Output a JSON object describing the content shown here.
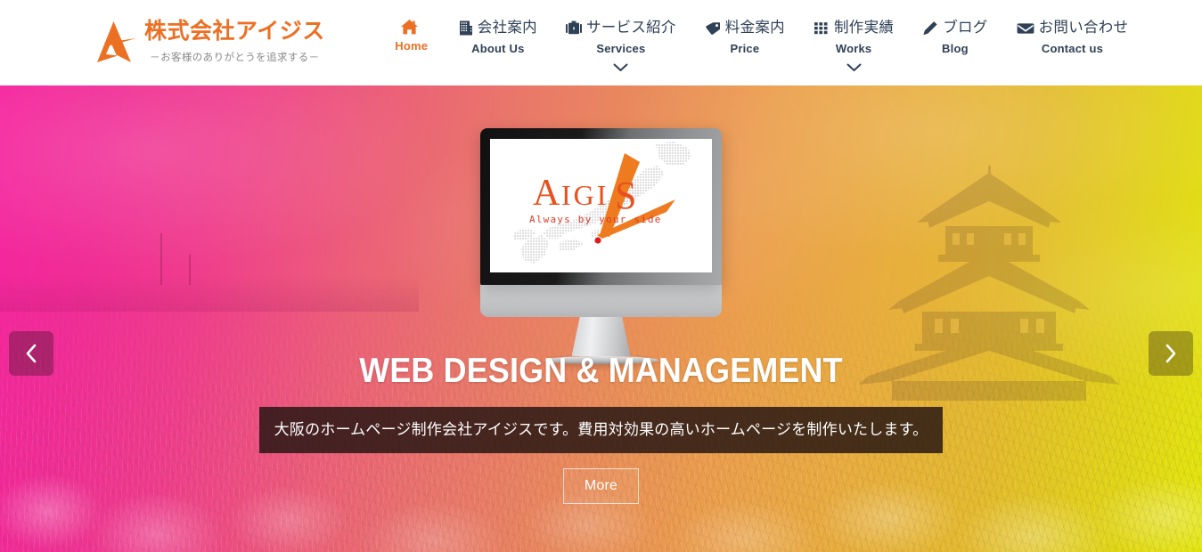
{
  "header": {
    "brand": {
      "logo_icon": "aigis-a-mark-icon",
      "name": "株式会社アイジス",
      "tagline": "－お客様のありがとうを追求する－",
      "accent_color": "#ec7024"
    },
    "nav": {
      "inactive_color": "#2f4156",
      "active_color": "#ec7024",
      "items": [
        {
          "id": "home",
          "icon": "home-icon",
          "ja": "",
          "en": "Home",
          "active": true,
          "has_dropdown": false
        },
        {
          "id": "about",
          "icon": "building-icon",
          "ja": "会社案内",
          "en": "About Us",
          "active": false,
          "has_dropdown": false
        },
        {
          "id": "services",
          "icon": "briefcase-icon",
          "ja": "サービス紹介",
          "en": "Services",
          "active": false,
          "has_dropdown": true
        },
        {
          "id": "price",
          "icon": "tag-icon",
          "ja": "料金案内",
          "en": "Price",
          "active": false,
          "has_dropdown": false
        },
        {
          "id": "works",
          "icon": "grid-icon",
          "ja": "制作実績",
          "en": "Works",
          "active": false,
          "has_dropdown": true
        },
        {
          "id": "blog",
          "icon": "pencil-icon",
          "ja": "ブログ",
          "en": "Blog",
          "active": false,
          "has_dropdown": false
        },
        {
          "id": "contact",
          "icon": "envelope-icon",
          "ja": "お問い合わせ",
          "en": "Contact us",
          "active": false,
          "has_dropdown": false
        }
      ]
    }
  },
  "hero": {
    "background": {
      "scene": "osaka-castle-with-cherry-blossoms",
      "gradient_start": "#f5259e",
      "gradient_mid": "#e98a5c",
      "gradient_end": "#e3e70d"
    },
    "monitor": {
      "device": "desktop-monitor",
      "screen": {
        "logo_text": "AIGIS",
        "logo_tagline": "Always by your side",
        "map": "japan-map",
        "marker": "osaka-marker",
        "logo_color": "#e8501e",
        "tagline_color": "#e03a2a",
        "map_color": "#c9c9c9"
      }
    },
    "title": "WEB DESIGN & MANAGEMENT",
    "description": "大阪のホームページ制作会社アイジスです。費用対効果の高いホームページを制作いたします。",
    "more_label": "More",
    "prev_label": "chevron-left-icon",
    "next_label": "chevron-right-icon"
  }
}
